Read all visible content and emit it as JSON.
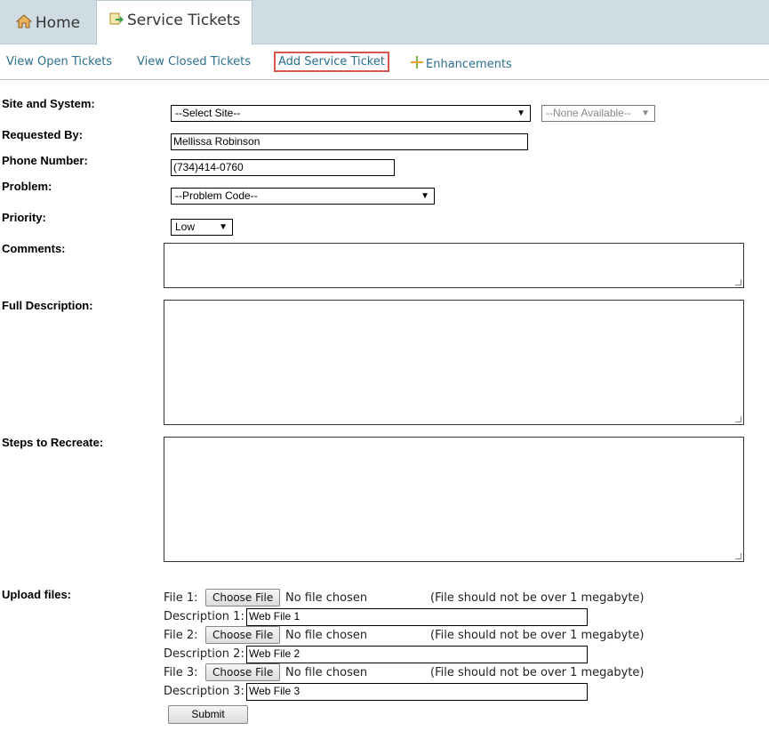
{
  "tabs": {
    "home_label": "Home",
    "service_tickets_label": "Service Tickets"
  },
  "subnav": {
    "view_open": "View Open Tickets",
    "view_closed": "View Closed Tickets",
    "add_ticket": "Add Service Ticket",
    "enhancements": "Enhancements"
  },
  "form": {
    "site_label": "Site and System:",
    "site_select": "--Select Site--",
    "system_select": "--None Available--",
    "requested_by_label": "Requested By:",
    "requested_by_value": "Mellissa Robinson",
    "phone_label": "Phone Number:",
    "phone_value": "(734)414-0760",
    "problem_label": "Problem:",
    "problem_select": "--Problem Code--",
    "priority_label": "Priority:",
    "priority_select": "Low",
    "comments_label": "Comments:",
    "full_description_label": "Full Description:",
    "steps_label": "Steps to Recreate:",
    "upload_label": "Upload files:"
  },
  "uploads": [
    {
      "file_label": "File 1:",
      "choose": "Choose File",
      "status": "No file chosen",
      "note": "(File should not be over 1 megabyte)",
      "desc_label": "Description 1:",
      "desc_value": "Web File 1"
    },
    {
      "file_label": "File 2:",
      "choose": "Choose File",
      "status": "No file chosen",
      "note": "(File should not be over 1 megabyte)",
      "desc_label": "Description 2:",
      "desc_value": "Web File 2"
    },
    {
      "file_label": "File 3:",
      "choose": "Choose File",
      "status": "No file chosen",
      "note": "(File should not be over 1 megabyte)",
      "desc_label": "Description 3:",
      "desc_value": "Web File 3"
    }
  ],
  "submit_label": "Submit",
  "colors": {
    "tabbar_bg": "#cfdce3",
    "link": "#2a6f8f",
    "selected_outline": "#d9534f"
  }
}
